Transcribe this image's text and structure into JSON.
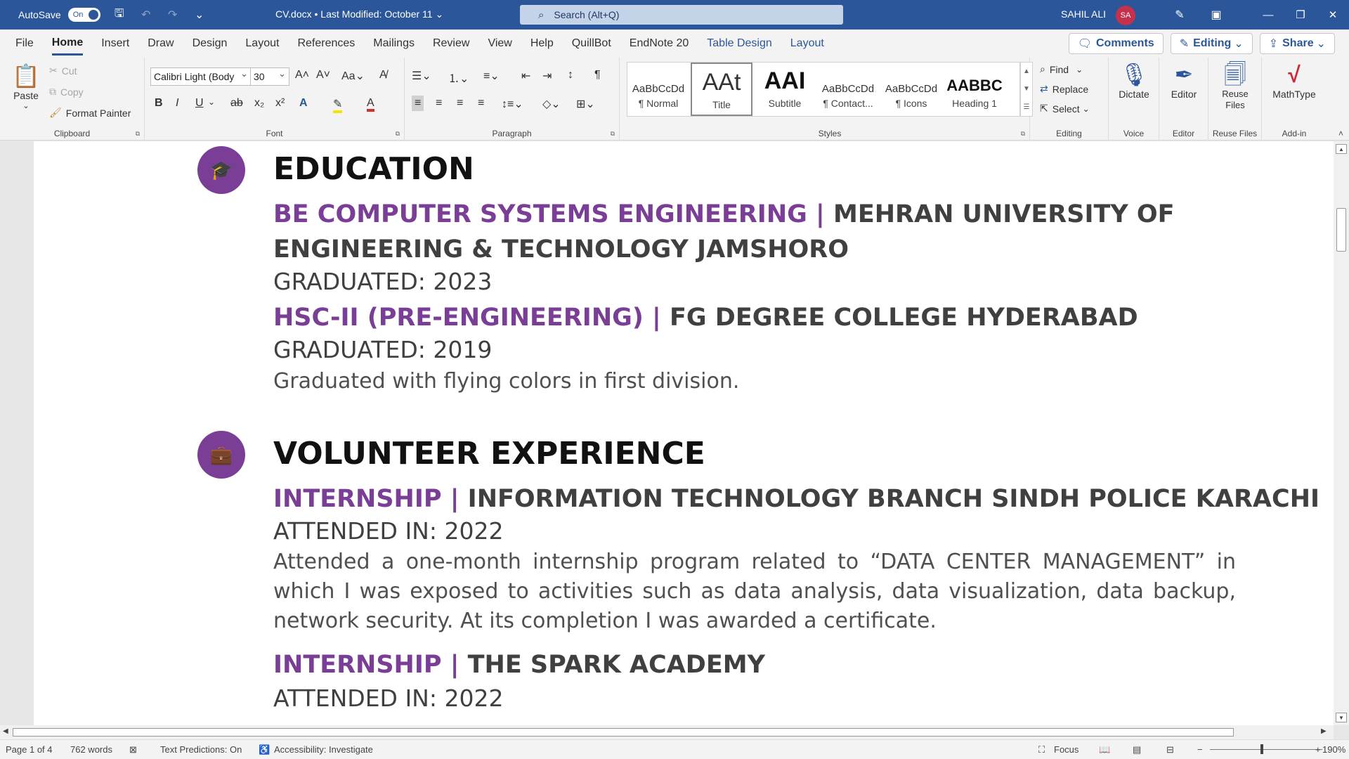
{
  "titlebar": {
    "autosave_label": "AutoSave",
    "autosave_state": "On",
    "doc_title": "CV.docx • Last Modified: October 11 ⌄",
    "search_placeholder": "Search (Alt+Q)",
    "user_name": "SAHIL ALI",
    "user_initials": "SA"
  },
  "menu": {
    "tabs": [
      "File",
      "Home",
      "Insert",
      "Draw",
      "Design",
      "Layout",
      "References",
      "Mailings",
      "Review",
      "View",
      "Help",
      "QuillBot",
      "EndNote 20",
      "Table Design",
      "Layout"
    ],
    "active_tab": "Home",
    "comments": "Comments",
    "editing": "Editing",
    "share": "Share"
  },
  "ribbon": {
    "clipboard": {
      "paste": "Paste",
      "cut": "Cut",
      "copy": "Copy",
      "format_painter": "Format Painter",
      "label": "Clipboard"
    },
    "font": {
      "family": "Calibri Light (Body",
      "size": "30",
      "label": "Font"
    },
    "paragraph": {
      "label": "Paragraph"
    },
    "styles": {
      "label": "Styles",
      "items": [
        {
          "sample": "AaBbCcDd",
          "name": "¶ Normal"
        },
        {
          "sample": "AAt",
          "name": "Title"
        },
        {
          "sample": "AAI",
          "name": "Subtitle"
        },
        {
          "sample": "AaBbCcDd",
          "name": "¶ Contact..."
        },
        {
          "sample": "AaBbCcDd",
          "name": "¶ Icons"
        },
        {
          "sample": "AABBC",
          "name": "Heading 1"
        }
      ]
    },
    "editing": {
      "find": "Find",
      "replace": "Replace",
      "select": "Select",
      "label": "Editing"
    },
    "voice": {
      "dictate": "Dictate",
      "label": "Voice"
    },
    "editor": {
      "editor": "Editor",
      "label": "Editor"
    },
    "reuse": {
      "reuse_files": "Reuse Files",
      "label": "Reuse Files"
    },
    "addin": {
      "mathtype": "MathType",
      "label": "Add-in"
    }
  },
  "document": {
    "education": {
      "heading": "EDUCATION",
      "entries": [
        {
          "degree": "BE COMPUTER SYSTEMS ENGINEERING | ",
          "school_line1": "MEHRAN UNIVERSITY OF",
          "school_line2": "ENGINEERING & TECHNOLOGY JAMSHORO",
          "date": "GRADUATED: 2023"
        },
        {
          "degree": "HSC-II (PRE-ENGINEERING) | ",
          "school": "FG DEGREE COLLEGE HYDERABAD",
          "date": "GRADUATED: 2019",
          "note": "Graduated with flying colors in first division."
        }
      ]
    },
    "volunteer": {
      "heading": "VOLUNTEER EXPERIENCE",
      "entries": [
        {
          "role": "INTERNSHIP | ",
          "org": "INFORMATION TECHNOLOGY BRANCH SINDH POLICE KARACHI",
          "date": "ATTENDED IN: 2022",
          "desc": "Attended a one-month internship program related to “DATA CENTER MANAGEMENT” in which I was exposed to activities such as data analysis, data visualization, data backup, network security. At its completion I was awarded a certificate."
        },
        {
          "role": "INTERNSHIP | ",
          "org": "THE SPARK ACADEMY",
          "date": "ATTENDED IN: 2022"
        }
      ]
    }
  },
  "status": {
    "page": "Page 1 of 4",
    "words": "762 words",
    "predictions": "Text Predictions: On",
    "accessibility": "Accessibility: Investigate",
    "focus": "Focus",
    "zoom": "190%"
  }
}
